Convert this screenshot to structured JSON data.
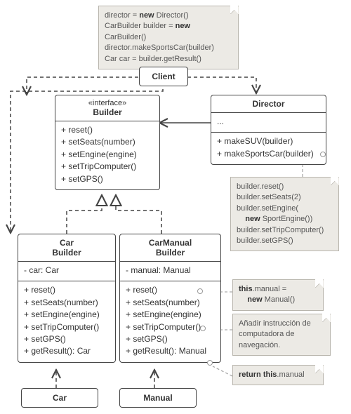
{
  "client_note": {
    "l1a": "director = ",
    "l1kw": "new",
    "l1b": " Director()",
    "l2a": "CarBuilder builder = ",
    "l2kw": "new",
    "l2b": " CarBuilder()",
    "l3": "director.makeSportsCar(builder)",
    "l4": "Car car = builder.getResult()"
  },
  "client": {
    "title": "Client"
  },
  "director": {
    "title": "Director",
    "ellipsis": "...",
    "m1": "+ makeSUV(builder)",
    "m2": "+ makeSportsCar(builder)"
  },
  "builder": {
    "stereo": "«interface»",
    "title": "Builder",
    "m1": "+ reset()",
    "m2": "+ setSeats(number)",
    "m3": "+ setEngine(engine)",
    "m4": "+ setTripComputer()",
    "m5": "+ setGPS()"
  },
  "carbuilder": {
    "title1": "Car",
    "title2": "Builder",
    "f1": "- car: Car",
    "m1": "+ reset()",
    "m2": "+ setSeats(number)",
    "m3": "+ setEngine(engine)",
    "m4": "+ setTripComputer()",
    "m5": "+ setGPS()",
    "m6": "+ getResult(): Car"
  },
  "manualbuilder": {
    "title1": "CarManual",
    "title2": "Builder",
    "f1": "- manual: Manual",
    "m1": "+ reset()",
    "m2": "+ setSeats(number)",
    "m3": "+ setEngine(engine)",
    "m4": "+ setTripComputer()",
    "m5": "+ setGPS()",
    "m6": "+ getResult(): Manual"
  },
  "car": {
    "title": "Car"
  },
  "manual": {
    "title": "Manual"
  },
  "director_note": {
    "l1": "builder.reset()",
    "l2": "builder.setSeats(2)",
    "l3": "builder.setEngine(",
    "l4_indent": "    ",
    "l4kw": "new",
    "l4b": " SportEngine())",
    "l5": "builder.setTripComputer()",
    "l6": "builder.setGPS()"
  },
  "reset_note": {
    "a": "this",
    "b": ".manual =",
    "c": "    ",
    "ckw": "new",
    "cb": " Manual()"
  },
  "trip_note": {
    "text": "Añadir instrucción de computadora de navegación."
  },
  "result_note": {
    "a": "return this",
    "b": ".manual"
  }
}
